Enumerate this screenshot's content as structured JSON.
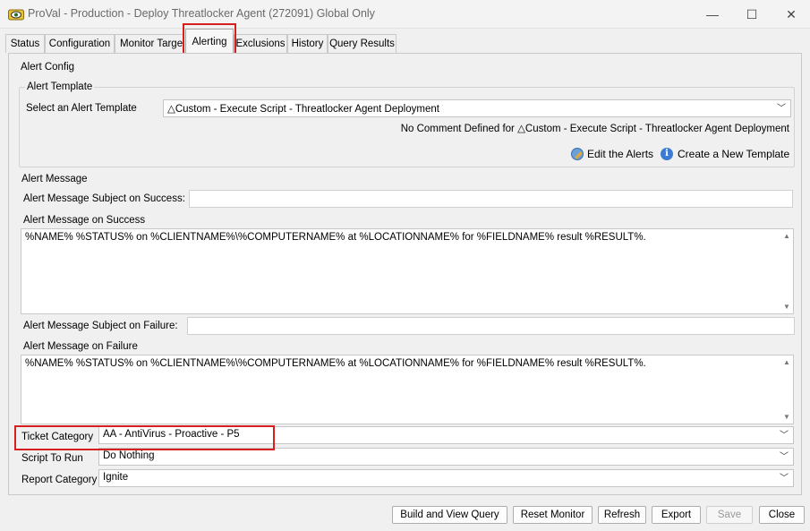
{
  "window": {
    "title": "ProVal - Production - Deploy Threatlocker Agent (272091) Global Only",
    "minimize_glyph": "—",
    "maximize_glyph": "☐",
    "close_glyph": "✕"
  },
  "tabs": [
    {
      "label": "Status"
    },
    {
      "label": "Configuration"
    },
    {
      "label": "Monitor Target"
    },
    {
      "label": "Alerting"
    },
    {
      "label": "Exclusions"
    },
    {
      "label": "History"
    },
    {
      "label": "Query Results"
    }
  ],
  "alert_config": {
    "title": "Alert Config",
    "template_group": {
      "title": "Alert Template",
      "select_label": "Select an Alert Template",
      "selected_template": "△Custom - Execute Script - Threatlocker Agent Deployment",
      "comment": "No Comment Defined for △Custom - Execute Script - Threatlocker Agent Deployment",
      "edit_alerts_label": "Edit the Alerts",
      "create_template_label": "Create a New Template"
    },
    "message_group": {
      "title": "Alert Message",
      "subject_success_label": "Alert Message Subject on Success:",
      "subject_success_value": "",
      "message_success_label": "Alert Message on Success",
      "message_success_value": "%NAME% %STATUS% on %CLIENTNAME%\\%COMPUTERNAME% at %LOCATIONNAME% for %FIELDNAME% result %RESULT%.",
      "subject_failure_label": "Alert Message Subject on Failure:",
      "subject_failure_value": "",
      "message_failure_label": "Alert Message on Failure",
      "message_failure_value": "%NAME% %STATUS% on %CLIENTNAME%\\%COMPUTERNAME% at %LOCATIONNAME% for %FIELDNAME% result %RESULT%."
    },
    "ticket_category_label": "Ticket Category",
    "ticket_category_value": "AA - AntiVirus - Proactive - P5",
    "script_to_run_label": "Script To Run",
    "script_to_run_value": "Do Nothing",
    "report_category_label": "Report Category",
    "report_category_value": "Ignite"
  },
  "buttons": {
    "build_view_query": "Build and View Query",
    "reset_monitor": "Reset Monitor",
    "refresh": "Refresh",
    "export": "Export",
    "save": "Save",
    "close": "Close"
  },
  "icons": {
    "arrow_down": "﹀",
    "scroll_up": "▲",
    "scroll_down": "▼",
    "info": "i"
  },
  "colors": {
    "highlight_red": "#d6201f",
    "info_blue": "#3b7bd4"
  }
}
